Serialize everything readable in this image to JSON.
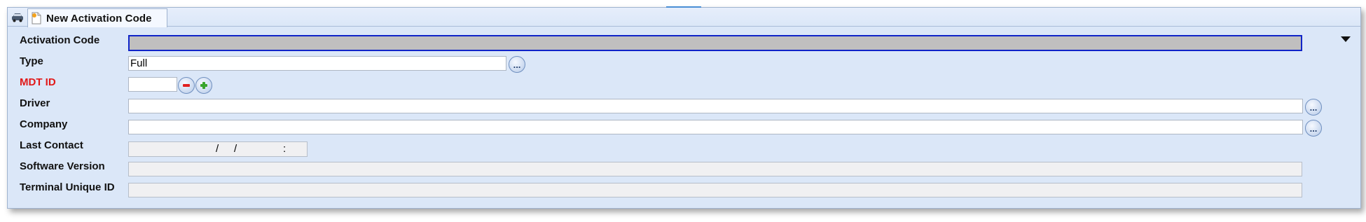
{
  "tabs": [
    {
      "icon": "car-icon"
    },
    {
      "icon": "new-document-icon",
      "label": "New Activation Code"
    }
  ],
  "form": {
    "activation_code": {
      "label": "Activation Code",
      "value": ""
    },
    "type": {
      "label": "Type",
      "value": "Full",
      "button": "..."
    },
    "mdt_id": {
      "label": "MDT ID",
      "value": "",
      "required": true,
      "required_color": "#e11818"
    },
    "driver": {
      "label": "Driver",
      "value": "",
      "button": "..."
    },
    "company": {
      "label": "Company",
      "value": "",
      "button": "..."
    },
    "last_contact": {
      "label": "Last Contact",
      "date_sep1": "/",
      "date_sep2": "/",
      "time_sep": ":"
    },
    "software_version": {
      "label": "Software Version",
      "value": ""
    },
    "terminal_unique_id": {
      "label": "Terminal Unique ID",
      "value": ""
    }
  },
  "colors": {
    "window_bg": "#dbe7f8",
    "focus_border": "#1024c8",
    "activation_field_bg": "#c0bfbf"
  }
}
